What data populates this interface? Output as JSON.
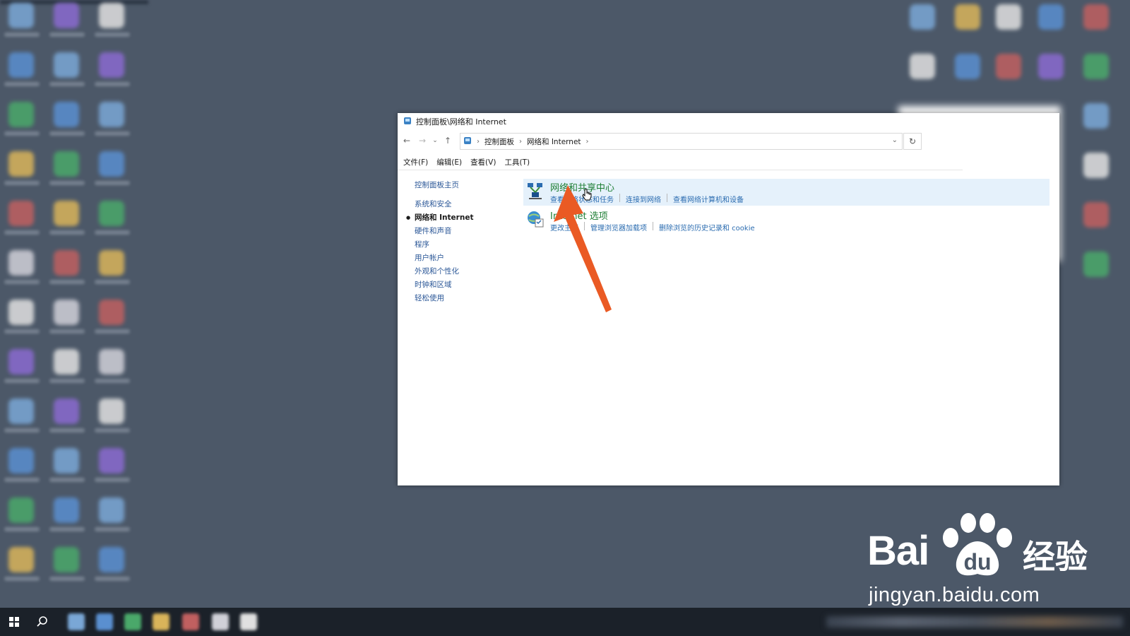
{
  "window": {
    "title": "控制面板\\网络和 Internet",
    "breadcrumb": [
      "控制面板",
      "网络和 Internet"
    ]
  },
  "menu": [
    "文件(F)",
    "编辑(E)",
    "查看(V)",
    "工具(T)"
  ],
  "sidebar": {
    "home": "控制面板主页",
    "items": [
      "系统和安全",
      "网络和 Internet",
      "硬件和声音",
      "程序",
      "用户帐户",
      "外观和个性化",
      "时钟和区域",
      "轻松使用"
    ]
  },
  "categories": [
    {
      "title": "网络和共享中心",
      "icon": "network-sharing-icon",
      "links": [
        "查看网络状态和任务",
        "连接到网络",
        "查看网络计算机和设备"
      ]
    },
    {
      "title": "Internet 选项",
      "icon": "internet-options-icon",
      "links": [
        "更改主页",
        "管理浏览器加载项",
        "删除浏览的历史记录和 cookie"
      ]
    }
  ],
  "watermark": {
    "brand": "Bai",
    "product": "经验",
    "url": "jingyan.baidu.com"
  },
  "colors": {
    "desktop": "#4c5868",
    "link": "#2b6cb0",
    "category_title": "#1e7e34",
    "highlight": "#e5f1fb",
    "arrow": "#ea5a24"
  }
}
